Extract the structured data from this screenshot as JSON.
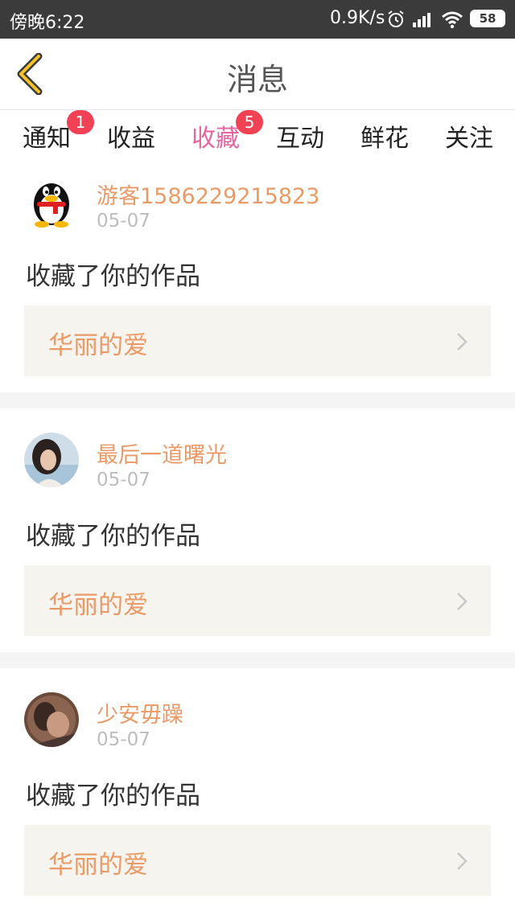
{
  "status_bar": {
    "time": "傍晚6:22",
    "speed": "0.9K/s",
    "battery": "58",
    "icons": [
      "alarm-icon",
      "signal-icon",
      "wifi-icon",
      "battery-icon"
    ]
  },
  "header": {
    "title": "消息",
    "back_icon": "back-chevron-icon",
    "accent": "#f5c22a"
  },
  "tabs": [
    {
      "label": "通知",
      "badge": "1"
    },
    {
      "label": "收益"
    },
    {
      "label": "收藏",
      "badge": "5",
      "active": true
    },
    {
      "label": "互动"
    },
    {
      "label": "鲜花"
    },
    {
      "label": "关注"
    }
  ],
  "colors": {
    "active_tab": "#e7659f",
    "badge": "#f04155",
    "username": "#ea9a67",
    "work_bg": "#f6f4ee"
  },
  "items": [
    {
      "username": "游客1586229215823",
      "date": "05-07",
      "action": "收藏了你的作品",
      "work": "华丽的爱",
      "avatar": "qq-penguin-avatar"
    },
    {
      "username": "最后一道曙光",
      "date": "05-07",
      "action": "收藏了你的作品",
      "work": "华丽的爱",
      "avatar": "photo-avatar"
    },
    {
      "username": "少安毋躁",
      "date": "05-07",
      "action": "收藏了你的作品",
      "work": "华丽的爱",
      "avatar": "photo-avatar"
    }
  ]
}
